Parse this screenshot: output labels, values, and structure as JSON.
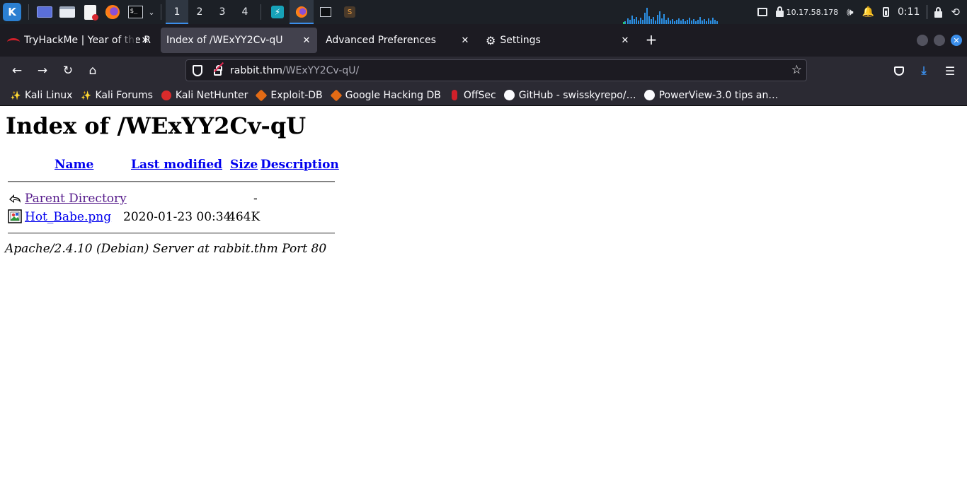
{
  "panel": {
    "workspaces": [
      "1",
      "2",
      "3",
      "4"
    ],
    "terminal_prompt": "$_",
    "ip_address": "10.17.58.178",
    "clock": "0:11"
  },
  "tabs": [
    {
      "title": "TryHackMe | Year of the R"
    },
    {
      "title": "Index of /WExYY2Cv-qU"
    },
    {
      "title": "Advanced Preferences"
    },
    {
      "title": "Settings"
    }
  ],
  "newtab_label": "+",
  "url": {
    "host": "rabbit.thm",
    "path": "/WExYY2Cv-qU/"
  },
  "bookmarks": [
    {
      "label": "Kali Linux",
      "icon": "kali-dragon-icon"
    },
    {
      "label": "Kali Forums",
      "icon": "kali-dragon-icon"
    },
    {
      "label": "Kali NetHunter",
      "icon": "nethunter-icon"
    },
    {
      "label": "Exploit-DB",
      "icon": "exploit-db-icon"
    },
    {
      "label": "Google Hacking DB",
      "icon": "exploit-db-icon"
    },
    {
      "label": "OffSec",
      "icon": "offsec-icon"
    },
    {
      "label": "GitHub - swisskyrepo/…",
      "icon": "github-icon"
    },
    {
      "label": "PowerView-3.0 tips an…",
      "icon": "github-icon"
    }
  ],
  "page": {
    "heading": "Index of /WExYY2Cv-qU",
    "columns": {
      "name": "Name",
      "last_modified": "Last modified",
      "size": "Size",
      "description": "Description"
    },
    "rows": [
      {
        "name": "Parent Directory",
        "last_modified": "",
        "size": "-",
        "description": "",
        "icon": "back-arrow-icon"
      },
      {
        "name": "Hot_Babe.png",
        "last_modified": "2020-01-23 00:34",
        "size": "464K",
        "description": "",
        "icon": "image-file-icon"
      }
    ],
    "address": "Apache/2.4.10 (Debian) Server at rabbit.thm Port 80"
  },
  "colors": {
    "link_visited": "#551a8b",
    "link": "#0000ee",
    "accent": "#3b8eea",
    "toolbar": "#2b2a33",
    "tabstrip": "#1c1b22"
  }
}
